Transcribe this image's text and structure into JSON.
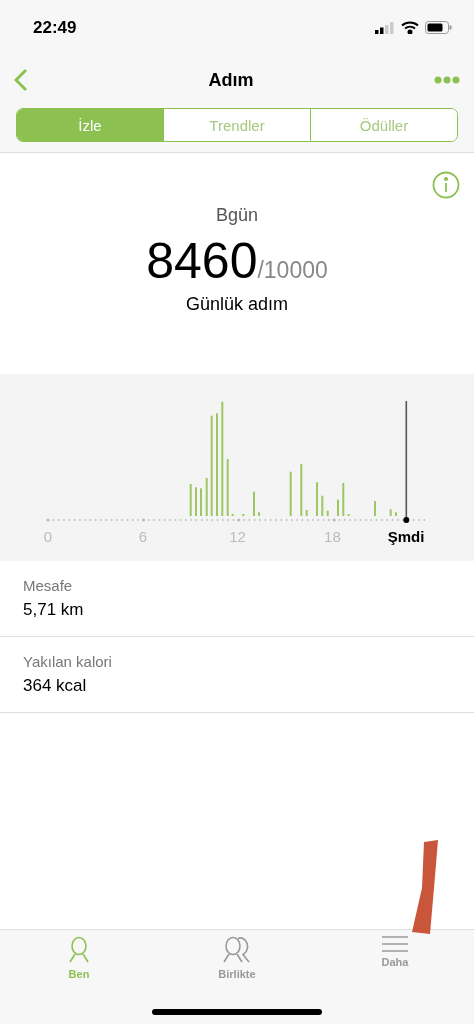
{
  "status_bar": {
    "time": "22:49"
  },
  "nav": {
    "title": "Adım"
  },
  "tabs": [
    {
      "label": "İzle",
      "selected": true
    },
    {
      "label": "Trendler",
      "selected": false
    },
    {
      "label": "Ödüller",
      "selected": false
    }
  ],
  "summary": {
    "period": "Bgün",
    "steps": "8460",
    "goal": "/10000",
    "caption": "Günlük adım"
  },
  "chart": {
    "axis_labels": [
      "0",
      "6",
      "12",
      "18"
    ],
    "now_label": "Şmdi"
  },
  "stats": [
    {
      "label": "Mesafe",
      "value": "5,71 km"
    },
    {
      "label": "Yakılan kalori",
      "value": "364 kcal"
    }
  ],
  "bottom_tabs": [
    {
      "label": "Ben",
      "kind": "person",
      "selected": true
    },
    {
      "label": "Birlikte",
      "kind": "group",
      "selected": false
    },
    {
      "label": "Daha",
      "kind": "menu",
      "selected": false
    }
  ]
}
